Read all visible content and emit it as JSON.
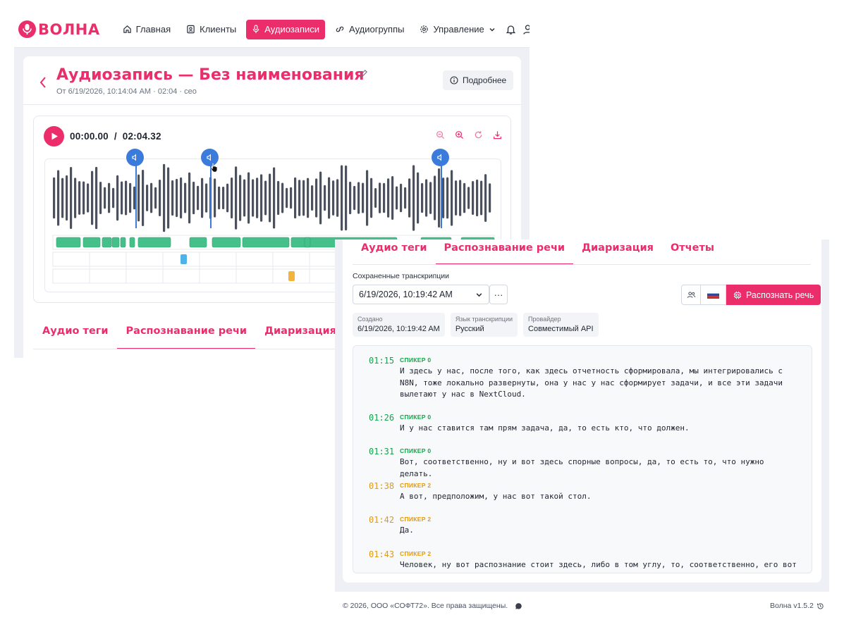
{
  "app": {
    "brand": "ВОЛНА",
    "accent_color": "#ec2d6c",
    "marker_color": "#3b7bdc"
  },
  "nav": {
    "items": [
      {
        "label": "Главная",
        "icon": "home-icon",
        "active": false
      },
      {
        "label": "Клиенты",
        "icon": "contacts-icon",
        "active": false
      },
      {
        "label": "Аудиозаписи",
        "icon": "microphone-icon",
        "active": true
      },
      {
        "label": "Аудиогруппы",
        "icon": "link-icon",
        "active": false
      },
      {
        "label": "Управление",
        "icon": "gear-icon",
        "active": false,
        "has_dropdown": true
      }
    ],
    "right_icons": [
      "bell-icon",
      "user-icon"
    ]
  },
  "recording": {
    "title": "Аудиозапись — Без наименования",
    "subtitle": "От 6/19/2026, 10:14:04 AM · 02:04 · ceo",
    "details_button": "Подробнее"
  },
  "player": {
    "current_time": "00:00.00",
    "separator": "/",
    "duration": "02:04.32",
    "tools": [
      "zoom-out-icon",
      "zoom-in-icon",
      "reset-icon",
      "download-icon"
    ],
    "marker_count": 3
  },
  "back_tabs": [
    {
      "label": "Аудио теги",
      "active": false
    },
    {
      "label": "Распознавание речи",
      "active": true
    },
    {
      "label": "Диаризация",
      "active": false
    }
  ],
  "front_tabs": [
    {
      "label": "Аудио теги",
      "active": false
    },
    {
      "label": "Распознавание речи",
      "active": true
    },
    {
      "label": "Диаризация",
      "active": false
    },
    {
      "label": "Отчеты",
      "active": false
    }
  ],
  "transcriptions": {
    "label": "Сохраненные транскрипции",
    "selected": "6/19/2026, 10:19:42 AM",
    "more_button": "···",
    "recognize_button": "Распознать речь",
    "meta": [
      {
        "label": "Создано",
        "value": "6/19/2026, 10:19:42 AM"
      },
      {
        "label": "Язык транскрипции",
        "value": "Русский"
      },
      {
        "label": "Провайдер",
        "value": "Совместимый API"
      }
    ],
    "segments": [
      {
        "time": "01:15",
        "speaker": "СПИКЕР 0",
        "color": "#16a34a",
        "text": "И здесь у нас, после того, как здесь отчетность сформировала, мы интегрировались с N8N, тоже локально развернуты, она у нас у нас сформирует задачи, и все эти задачи вылетают у нас в NextCloud."
      },
      {
        "time": "01:26",
        "speaker": "СПИКЕР 0",
        "color": "#16a34a",
        "text": "И у нас ставится там прям задача, да, то есть кто, что должен."
      },
      {
        "time": "01:31",
        "speaker": "СПИКЕР 0",
        "color": "#16a34a",
        "text": "Вот, соответственно, ну и вот здесь спорные вопросы, да, то есть то, что нужно делать."
      },
      {
        "time": "01:38",
        "speaker": "СПИКЕР 2",
        "color": "#e09a14",
        "text": "А вот, предположим, у нас вот такой стол."
      },
      {
        "time": "01:42",
        "speaker": "СПИКЕР 2",
        "color": "#e09a14",
        "text": "Да."
      },
      {
        "time": "01:43",
        "speaker": "СПИКЕР 2",
        "color": "#e09a14",
        "text": "Человек, ну вот распознание стоит здесь, либо в том углу, то, соответственно, его вот"
      }
    ]
  },
  "footer": {
    "copyright": "© 2026, ООО «СОФТ72». Все права защищены.",
    "version": "Волна v1.5.2"
  }
}
